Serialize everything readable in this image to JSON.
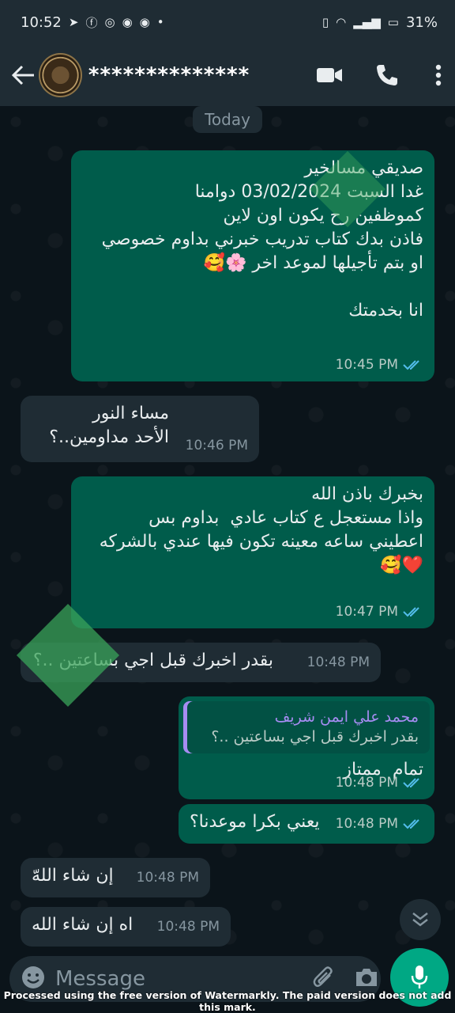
{
  "status_bar": {
    "time": "10:52",
    "battery": "31%"
  },
  "header": {
    "contact_name": "**************"
  },
  "date_chip": "Today",
  "messages": [
    {
      "dir": "out",
      "text": "صديقي مسالخير\nغدا السبت 03/02/2024 دوامنا\nكموظفين رح يكون اون لاين\nفاذن بدك كتاب تدريب خبرني بداوم خصوصي\nاو بتم تأجيلها لموعد اخر 🌸🥰\n\nانا بخدمتك",
      "time": "10:45 PM"
    },
    {
      "dir": "in",
      "text": "مساء النور\nالأحد مداومين..؟",
      "time": "10:46 PM"
    },
    {
      "dir": "out",
      "text": "بخبرك باذن الله\nواذا مستعجل ع كتاب عادي  بداوم بس\nاعطيني ساعه معينه تكون فيها عندي بالشركه\n❤️🥰",
      "time": "10:47 PM"
    },
    {
      "dir": "in",
      "text": "بقدر اخبرك قبل اجي بساعتين ..؟",
      "time": "10:48 PM"
    },
    {
      "dir": "out",
      "quote_author": "محمد علي ايمن شريف",
      "quote_text": "بقدر اخبرك قبل اجي بساعتين ..؟",
      "text": "تمام  ممتاز",
      "time": "10:48 PM"
    },
    {
      "dir": "out",
      "text": "يعني بكرا موعدنا؟",
      "time": "10:48 PM"
    },
    {
      "dir": "in",
      "text": "إن شاء اللهّ",
      "time": "10:48 PM"
    },
    {
      "dir": "in",
      "text": "اه إن شاء الله",
      "time": "10:48 PM"
    }
  ],
  "composer": {
    "placeholder": "Message"
  },
  "watermark_notice": "Processed using the free version of Watermarkly. The paid version does not add this mark.",
  "colors": {
    "outgoing": "#005c4b",
    "incoming": "#1f2c34",
    "accent": "#00a884",
    "read_ticks": "#53bdeb"
  }
}
